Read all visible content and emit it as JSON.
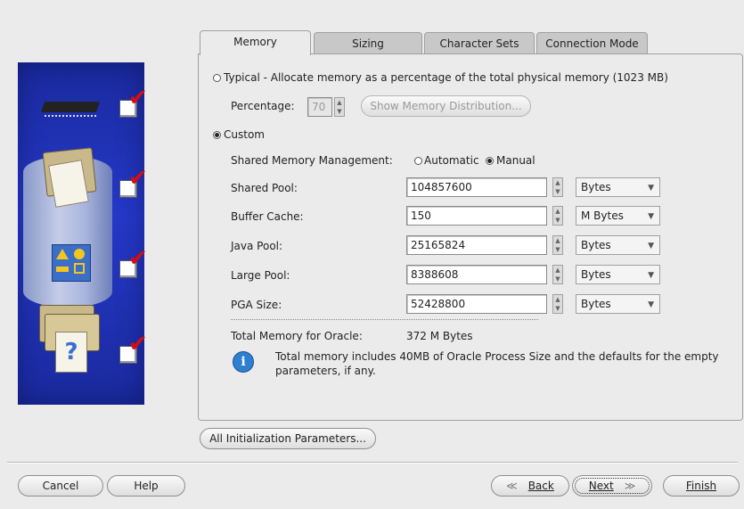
{
  "tabs": [
    {
      "label": "Memory"
    },
    {
      "label": "Sizing"
    },
    {
      "label": "Character Sets"
    },
    {
      "label": "Connection Mode"
    }
  ],
  "typical": {
    "label": "Typical - Allocate memory as a percentage of the total physical memory (1023 MB)",
    "percentage_label": "Percentage:",
    "percentage_value": "70",
    "show_distribution_button": "Show Memory Distribution..."
  },
  "custom": {
    "label": "Custom",
    "shared_mgmt_label": "Shared Memory Management:",
    "automatic_label": "Automatic",
    "manual_label": "Manual"
  },
  "pools": [
    {
      "label": "Shared Pool:",
      "value": "104857600",
      "unit": "Bytes"
    },
    {
      "label": "Buffer Cache:",
      "value": "150",
      "unit": "M Bytes"
    },
    {
      "label": "Java Pool:",
      "value": "25165824",
      "unit": "Bytes"
    },
    {
      "label": "Large Pool:",
      "value": "8388608",
      "unit": "Bytes"
    },
    {
      "label": "PGA Size:",
      "value": "52428800",
      "unit": "Bytes"
    }
  ],
  "total": {
    "label": "Total Memory for Oracle:",
    "value": "372 M Bytes",
    "info": "Total memory includes 40MB of Oracle Process Size and the defaults for the empty parameters, if any."
  },
  "buttons": {
    "all_params": "All Initialization Parameters...",
    "cancel": "Cancel",
    "help": "Help",
    "back": "Back",
    "next": "Next",
    "finish": "Finish"
  },
  "icons": {
    "info": "i",
    "back_arrow": "≪",
    "next_arrow": "≫",
    "check_mark": "✔",
    "question": "?"
  }
}
